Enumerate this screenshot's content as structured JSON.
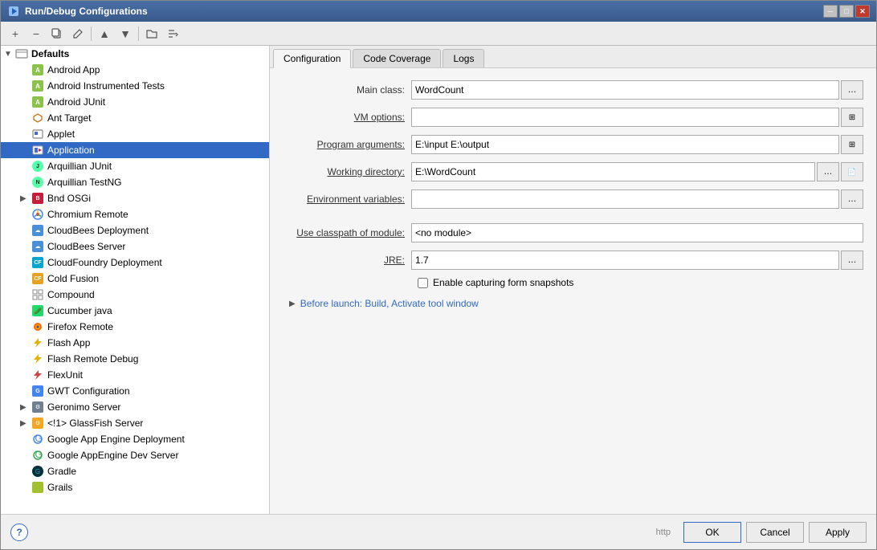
{
  "window": {
    "title": "Run/Debug Configurations"
  },
  "toolbar": {
    "buttons": [
      "+",
      "−",
      "📋",
      "✏️",
      "↑",
      "↓",
      "📁",
      "↕"
    ]
  },
  "sidebar": {
    "defaults_label": "Defaults",
    "items": [
      {
        "id": "android-app",
        "label": "Android App",
        "indent": 1,
        "icon": "android"
      },
      {
        "id": "android-instrumented",
        "label": "Android Instrumented Tests",
        "indent": 1,
        "icon": "android"
      },
      {
        "id": "android-junit",
        "label": "Android JUnit",
        "indent": 1,
        "icon": "android"
      },
      {
        "id": "ant-target",
        "label": "Ant Target",
        "indent": 1,
        "icon": "ant"
      },
      {
        "id": "applet",
        "label": "Applet",
        "indent": 1,
        "icon": "applet"
      },
      {
        "id": "application",
        "label": "Application",
        "indent": 1,
        "icon": "application",
        "selected": true
      },
      {
        "id": "arquillian-junit",
        "label": "Arquillian JUnit",
        "indent": 1,
        "icon": "junit"
      },
      {
        "id": "arquillian-testng",
        "label": "Arquillian TestNG",
        "indent": 1,
        "icon": "testng"
      },
      {
        "id": "bnd-osgi",
        "label": "Bnd OSGi",
        "indent": 1,
        "icon": "bnd",
        "expandable": true
      },
      {
        "id": "chromium-remote",
        "label": "Chromium Remote",
        "indent": 1,
        "icon": "chromium"
      },
      {
        "id": "cloudbees-deployment",
        "label": "CloudBees Deployment",
        "indent": 1,
        "icon": "cloudbees"
      },
      {
        "id": "cloudbees-server",
        "label": "CloudBees Server",
        "indent": 1,
        "icon": "cloudbees"
      },
      {
        "id": "cloudfoundry-deployment",
        "label": "CloudFoundry Deployment",
        "indent": 1,
        "icon": "cf"
      },
      {
        "id": "cold-fusion",
        "label": "Cold Fusion",
        "indent": 1,
        "icon": "coldfusion"
      },
      {
        "id": "compound",
        "label": "Compound",
        "indent": 1,
        "icon": "compound"
      },
      {
        "id": "cucumber-java",
        "label": "Cucumber java",
        "indent": 1,
        "icon": "cucumber"
      },
      {
        "id": "firefox-remote",
        "label": "Firefox Remote",
        "indent": 1,
        "icon": "firefox"
      },
      {
        "id": "flash-app",
        "label": "Flash App",
        "indent": 1,
        "icon": "flash"
      },
      {
        "id": "flash-remote-debug",
        "label": "Flash Remote Debug",
        "indent": 1,
        "icon": "flash"
      },
      {
        "id": "flexunit",
        "label": "FlexUnit",
        "indent": 1,
        "icon": "flex"
      },
      {
        "id": "gwt-configuration",
        "label": "GWT Configuration",
        "indent": 1,
        "icon": "gwt"
      },
      {
        "id": "geronimo-server",
        "label": "Geronimo Server",
        "indent": 1,
        "icon": "geronimo",
        "expandable": true
      },
      {
        "id": "glassfish-server",
        "label": "GlassFish Server",
        "indent": 1,
        "icon": "glassfish",
        "expandable": true
      },
      {
        "id": "google-app-engine",
        "label": "Google App Engine Deployment",
        "indent": 1,
        "icon": "google"
      },
      {
        "id": "google-appengine-dev",
        "label": "Google AppEngine Dev Server",
        "indent": 1,
        "icon": "google"
      },
      {
        "id": "gradle",
        "label": "Gradle",
        "indent": 1,
        "icon": "gradle"
      },
      {
        "id": "grails",
        "label": "Grails",
        "indent": 1,
        "icon": "grails"
      }
    ]
  },
  "tabs": [
    {
      "id": "configuration",
      "label": "Configuration",
      "active": true
    },
    {
      "id": "code-coverage",
      "label": "Code Coverage",
      "active": false
    },
    {
      "id": "logs",
      "label": "Logs",
      "active": false
    }
  ],
  "form": {
    "main_class_label": "Main class:",
    "main_class_value": "WordCount",
    "vm_options_label": "VM options:",
    "vm_options_value": "",
    "program_args_label": "Program arguments:",
    "program_args_value": "E:\\input E:\\output",
    "working_dir_label": "Working directory:",
    "working_dir_value": "E:\\WordCount",
    "env_vars_label": "Environment variables:",
    "env_vars_value": "",
    "module_label": "Use classpath of module:",
    "module_value": "<no module>",
    "jre_label": "JRE:",
    "jre_value": "1.7",
    "checkbox_label": "Enable capturing form snapshots",
    "before_launch_label": "Before launch: Build, Activate tool window"
  },
  "buttons": {
    "ok_label": "OK",
    "cancel_label": "Cancel",
    "apply_label": "Apply"
  },
  "url_hint": "http"
}
